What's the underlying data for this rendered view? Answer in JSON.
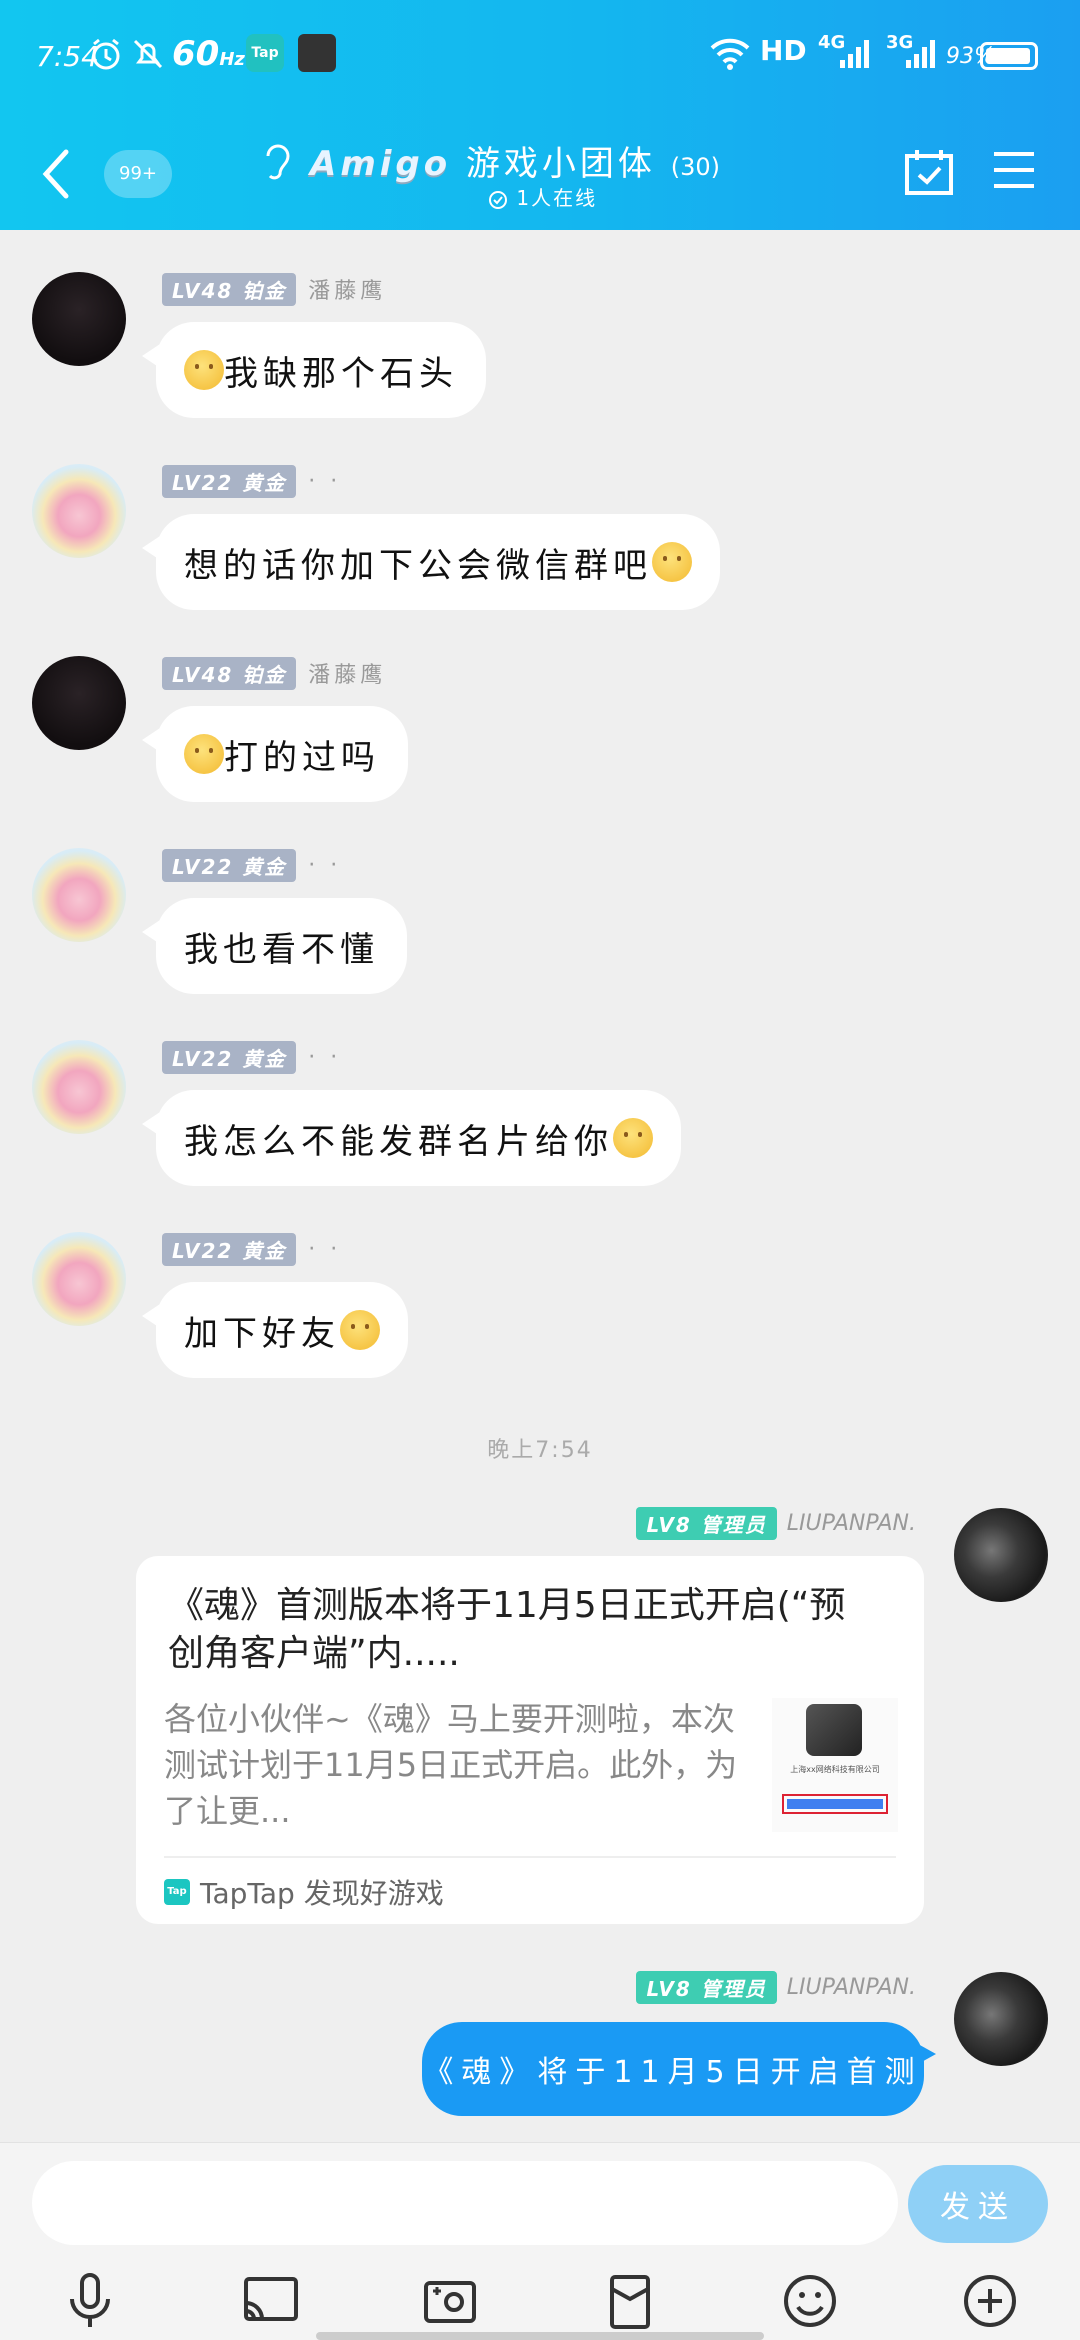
{
  "status_bar": {
    "time": "7:54",
    "refresh_rate": "60",
    "refresh_unit": "Hz",
    "tap_badge": "Tap",
    "network": "HD",
    "sig_4g": "4G",
    "sig_3g": "3G",
    "battery": "93%"
  },
  "header": {
    "unread_count": "99+",
    "brand": "Amigo",
    "group_name": "游戏小团体",
    "member_count": "(30)",
    "online": "1人在线"
  },
  "messages": [
    {
      "level": "LV48 铂金",
      "nick": "潘藤鹰",
      "text": "我缺那个石头",
      "emoji_pos": "before"
    },
    {
      "level": "LV22 黄金",
      "nick": "· ·",
      "text": "想的话你加下公会微信群吧",
      "emoji_pos": "after"
    },
    {
      "level": "LV48 铂金",
      "nick": "潘藤鹰",
      "text": "打的过吗",
      "emoji_pos": "before"
    },
    {
      "level": "LV22 黄金",
      "nick": "· ·",
      "text": "我也看不懂",
      "emoji_pos": "none"
    },
    {
      "level": "LV22 黄金",
      "nick": "· ·",
      "text": "我怎么不能发群名片给你",
      "emoji_pos": "after"
    },
    {
      "level": "LV22 黄金",
      "nick": "· ·",
      "text": "加下好友",
      "emoji_pos": "after"
    }
  ],
  "timestamp": "晚上7:54",
  "admin_msgs": [
    {
      "level": "LV8 管理员",
      "nick": "LIUPANPAN."
    },
    {
      "level": "LV8 管理员",
      "nick": "LIUPANPAN."
    }
  ],
  "card": {
    "title": "《魂》首测版本将于11月5日正式开启(“预创角客户端”内.....",
    "desc": "各位小伙伴~《魂》马上要开测啦，本次测试计划于11月5日正式开启。此外，为了让更...",
    "source": "TapTap 发现好游戏",
    "tap_icon": "Tap",
    "thumb_text": "上海xx网络科技有限公司"
  },
  "sent_text": "《魂》将于11月5日开启首测",
  "input": {
    "placeholder": "",
    "send_label": "发送"
  },
  "toolbar": [
    "mic-icon",
    "cast-icon",
    "camera-icon",
    "redpacket-icon",
    "emoji-icon",
    "plus-icon"
  ],
  "colors": {
    "header_start": "#12c6f0",
    "header_end": "#1b9ff1",
    "sent_bubble": "#1a9af4",
    "send_button": "#8fd0f6",
    "admin_badge": "#3ecdb2"
  }
}
